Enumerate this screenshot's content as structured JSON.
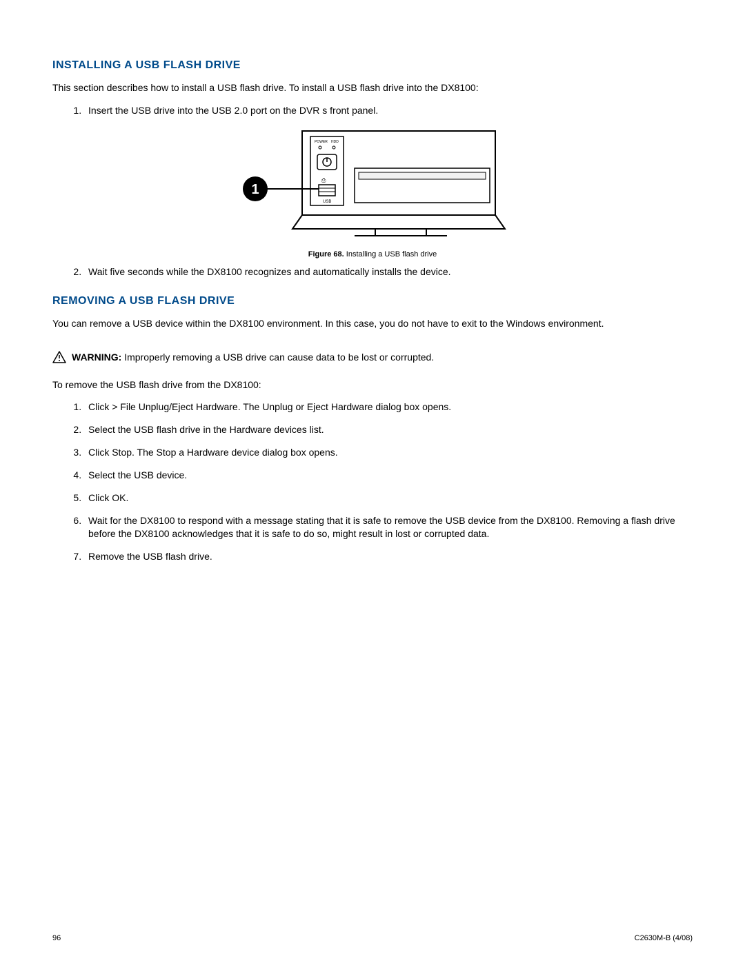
{
  "section1": {
    "heading": "INSTALLING A USB FLASH DRIVE",
    "intro": "This section describes how to install a USB flash drive. To install a USB flash drive into the DX8100:",
    "step1": "Insert the USB drive into the USB 2.0 port on the DVR s front panel.",
    "step2": "Wait five seconds while the DX8100 recognizes and automatically installs the device."
  },
  "figure": {
    "label": "Figure 68.",
    "caption": "Installing a USB flash drive",
    "callout": "1",
    "power_label": "POWER",
    "hdd_label": "HDD",
    "usb_label": "USB"
  },
  "section2": {
    "heading": "REMOVING A USB FLASH DRIVE",
    "intro": "You can remove a USB device within the DX8100 environment. In this case, you do not have to exit to the Windows environment.",
    "warning_label": "WARNING:",
    "warning_text": "Improperly removing a USB drive can cause data to be lost or corrupted.",
    "lead": "To remove the USB flash drive from the DX8100:",
    "steps": [
      "Click > File Unplug/Eject Hardware. The Unplug or Eject Hardware dialog box opens.",
      "Select the USB flash drive in the Hardware devices list.",
      "Click Stop. The Stop a Hardware device dialog box opens.",
      "Select the USB device.",
      "Click OK.",
      "Wait for the DX8100 to respond with a message stating that it is safe to remove the USB device from the DX8100. Removing a flash drive before the DX8100 acknowledges that it is safe to do so, might result in lost or corrupted data.",
      "Remove the USB flash drive."
    ]
  },
  "footer": {
    "page_number": "96",
    "doc_id": "C2630M-B (4/08)"
  }
}
